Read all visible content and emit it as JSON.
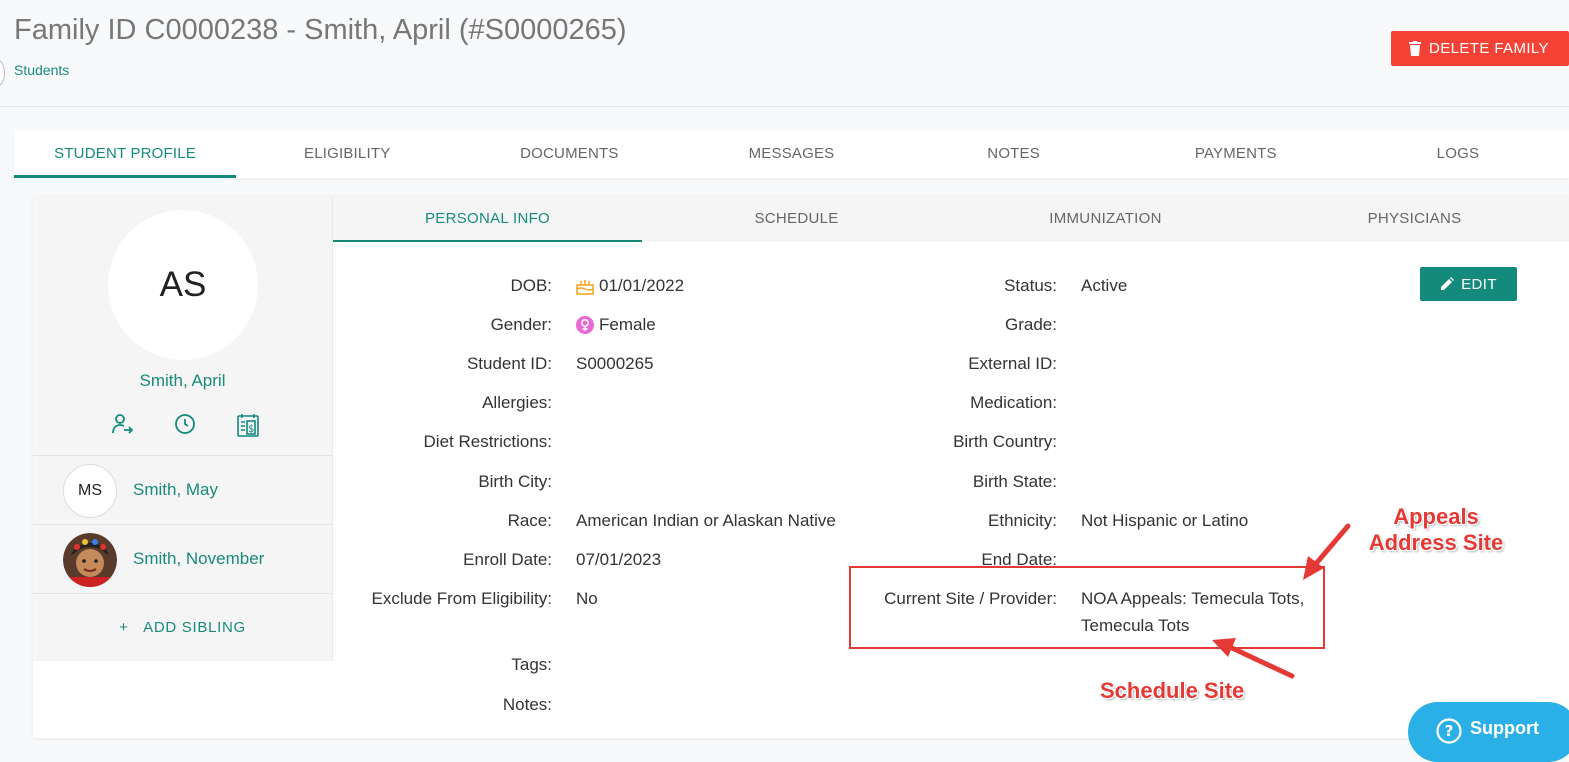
{
  "header": {
    "title": "Family ID C0000238 - Smith, April (#S0000265)",
    "breadcrumb": "Students",
    "delete_label": "DELETE FAMILY"
  },
  "main_tabs": [
    "STUDENT PROFILE",
    "ELIGIBILITY",
    "DOCUMENTS",
    "MESSAGES",
    "NOTES",
    "PAYMENTS",
    "LOGS"
  ],
  "sidebar": {
    "initials": "AS",
    "name": "Smith, April",
    "siblings": [
      {
        "initials": "MS",
        "name": "Smith, May"
      },
      {
        "initials": "",
        "name": "Smith, November"
      }
    ],
    "add_sibling": "ADD SIBLING"
  },
  "sub_tabs": [
    "PERSONAL INFO",
    "SCHEDULE",
    "IMMUNIZATION",
    "PHYSICIANS"
  ],
  "edit_label": "EDIT",
  "left_fields": [
    {
      "label": "DOB:",
      "value": "01/01/2022",
      "icon": "cake-icon"
    },
    {
      "label": "Gender:",
      "value": "Female",
      "icon": "female-icon"
    },
    {
      "label": "Student ID:",
      "value": "S0000265"
    },
    {
      "label": "Allergies:",
      "value": ""
    },
    {
      "label": "Diet Restrictions:",
      "value": ""
    },
    {
      "label": "Birth City:",
      "value": ""
    },
    {
      "label": "Race:",
      "value": "American Indian or Alaskan Native"
    },
    {
      "label": "Enroll Date:",
      "value": "07/01/2023"
    },
    {
      "label": "Exclude From Eligibility:",
      "value": "No"
    },
    {
      "label": "Tags:",
      "value": ""
    },
    {
      "label": "Notes:",
      "value": ""
    }
  ],
  "right_fields": [
    {
      "label": "Status:",
      "value": "Active"
    },
    {
      "label": "Grade:",
      "value": ""
    },
    {
      "label": "External ID:",
      "value": ""
    },
    {
      "label": "Medication:",
      "value": ""
    },
    {
      "label": "Birth Country:",
      "value": ""
    },
    {
      "label": "Birth State:",
      "value": ""
    },
    {
      "label": "Ethnicity:",
      "value": "Not Hispanic or Latino"
    },
    {
      "label": "End Date:",
      "value": ""
    },
    {
      "label": "Current Site / Provider:",
      "value": "NOA Appeals: Temecula Tots,",
      "value2": "Temecula Tots"
    }
  ],
  "annotations": {
    "appeals": "Appeals Address Site",
    "appeals_line1": "Appeals",
    "appeals_line2": "Address Site",
    "schedule": "Schedule Site"
  },
  "support_label": "Support",
  "colors": {
    "accent": "#138a7c",
    "danger": "#f44336",
    "annotation": "#e53935",
    "support": "#2ab0e6"
  }
}
